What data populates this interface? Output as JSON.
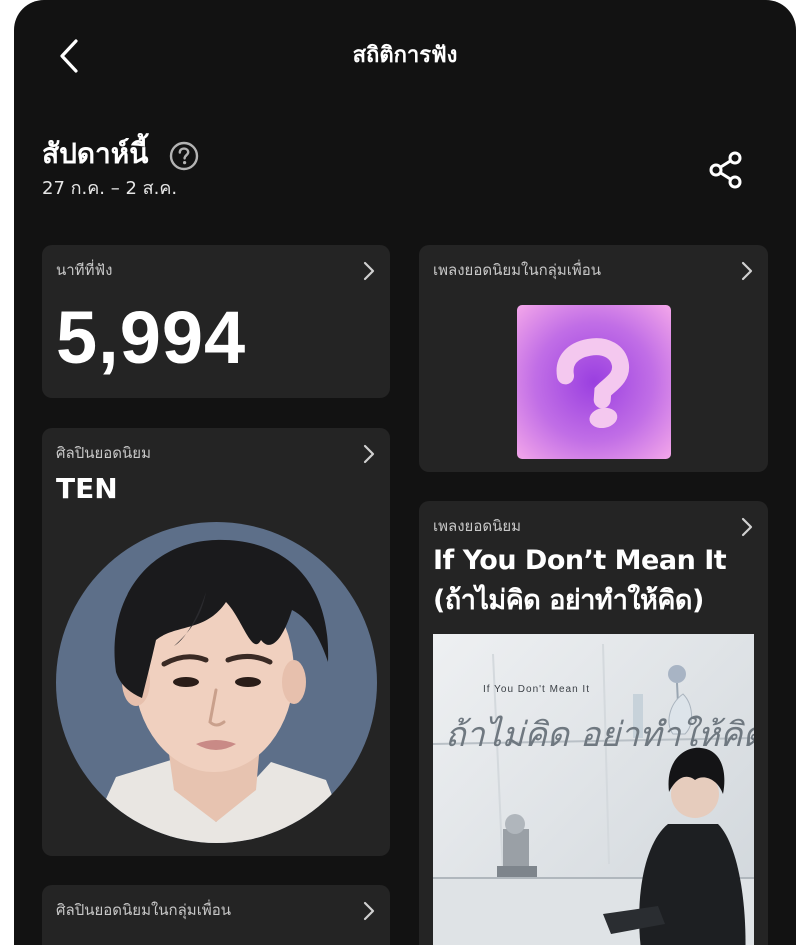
{
  "header": {
    "title": "สถิติการฟัง"
  },
  "period": {
    "title": "สัปดาห์นี้",
    "range": "27 ก.ค. – 2 ส.ค."
  },
  "cards": {
    "minutes": {
      "label": "นาทีที่ฟัง",
      "value": "5,994"
    },
    "friends_top_song": {
      "label": "เพลงยอดนิยมในกลุ่มเพื่อน"
    },
    "top_artist": {
      "label": "ศิลปินยอดนิยม",
      "name": "TEN"
    },
    "top_song": {
      "label": "เพลงยอดนิยม",
      "title": "If You Don’t Mean It (ถ้าไม่คิด อย่าทำให้คิด)",
      "cover_text_small": "If You Don't Mean It",
      "cover_text_large": "ถ้าไม่คิด อย่าทำให้คิด"
    },
    "friends_top_artist": {
      "label": "ศิลปินยอดนิยมในกลุ่มเพื่อน"
    }
  },
  "colors": {
    "background": "#121212",
    "card": "#242424",
    "mystery_gradient_light": "#f3a6ea",
    "mystery_gradient_dark": "#9a3fe0",
    "artist_backdrop": "#5d6f89"
  },
  "icons": {
    "back": "chevron-left-icon",
    "help": "question-circle-icon",
    "share": "share-icon",
    "card_arrow": "chevron-right-icon"
  }
}
